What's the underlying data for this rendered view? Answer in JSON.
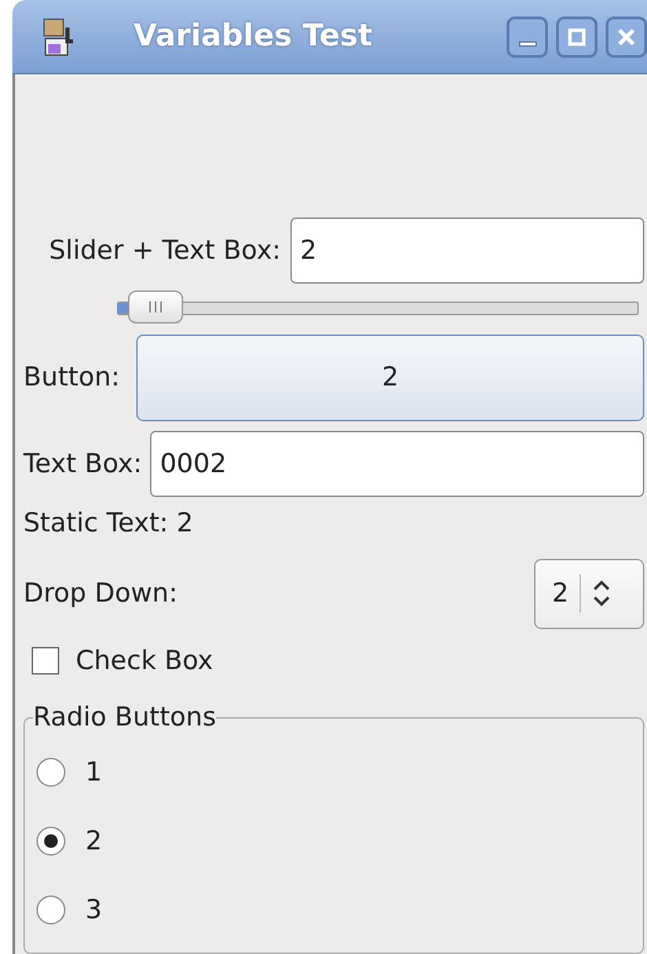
{
  "window": {
    "title": "Variables Test"
  },
  "slider_row": {
    "label": "Slider + Text Box:",
    "value": "2",
    "level": 0.02
  },
  "button_row": {
    "label": "Button:",
    "button": "2"
  },
  "text_box_row": {
    "label": "Text Box:",
    "value": "0002"
  },
  "static_text": "Static Text: 2",
  "drop_down_row": {
    "label": "Drop Down:",
    "value": "2"
  },
  "check_box": {
    "label": "Check Box",
    "checked": false
  },
  "radio_group": {
    "title": "Radio Buttons",
    "options": [
      {
        "label": "1",
        "selected": false
      },
      {
        "label": "2",
        "selected": true
      },
      {
        "label": "3",
        "selected": false
      }
    ]
  }
}
